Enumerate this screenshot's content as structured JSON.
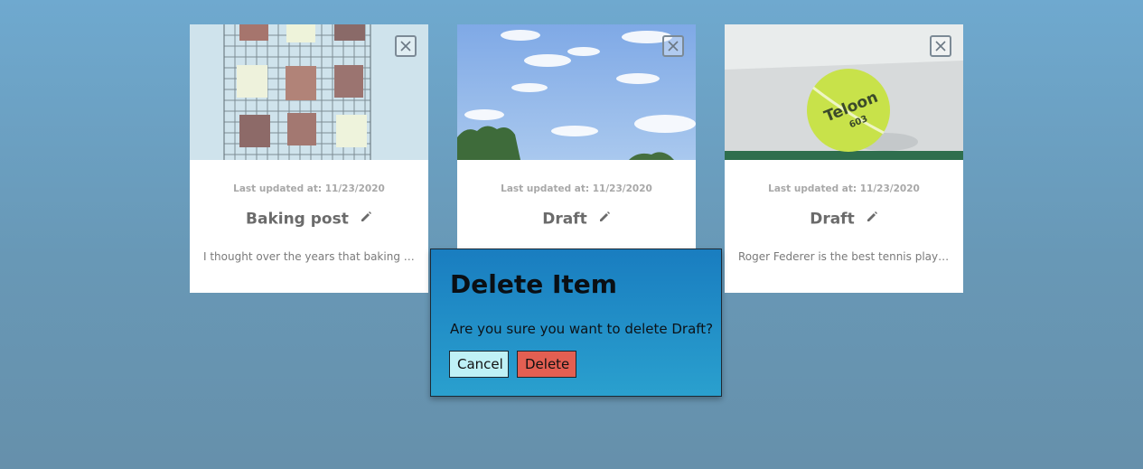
{
  "cards": [
    {
      "updated": "Last updated at: 11/23/2020",
      "title": "Baking post",
      "excerpt": "I thought over the years that baking brownies was easy",
      "image": "baking-photo"
    },
    {
      "updated": "Last updated at: 11/23/2020",
      "title": "Draft",
      "excerpt": "",
      "image": "sky-photo"
    },
    {
      "updated": "Last updated at: 11/23/2020",
      "title": "Draft",
      "excerpt": "Roger Federer is the best tennis player of all time",
      "image": "tennis-ball-photo"
    }
  ],
  "modal": {
    "title": "Delete Item",
    "message": "Are you sure you want to delete Draft?",
    "cancel_label": "Cancel",
    "delete_label": "Delete"
  },
  "icons": {
    "close": "close-icon",
    "edit": "pencil-icon"
  },
  "colors": {
    "background": "#6fa9cf",
    "modal_top": "#197dc0",
    "modal_bottom": "#2aa0ce",
    "cancel_button": "#bff1f6",
    "delete_button": "#e35f52",
    "card_title": "#6b6b6b"
  }
}
